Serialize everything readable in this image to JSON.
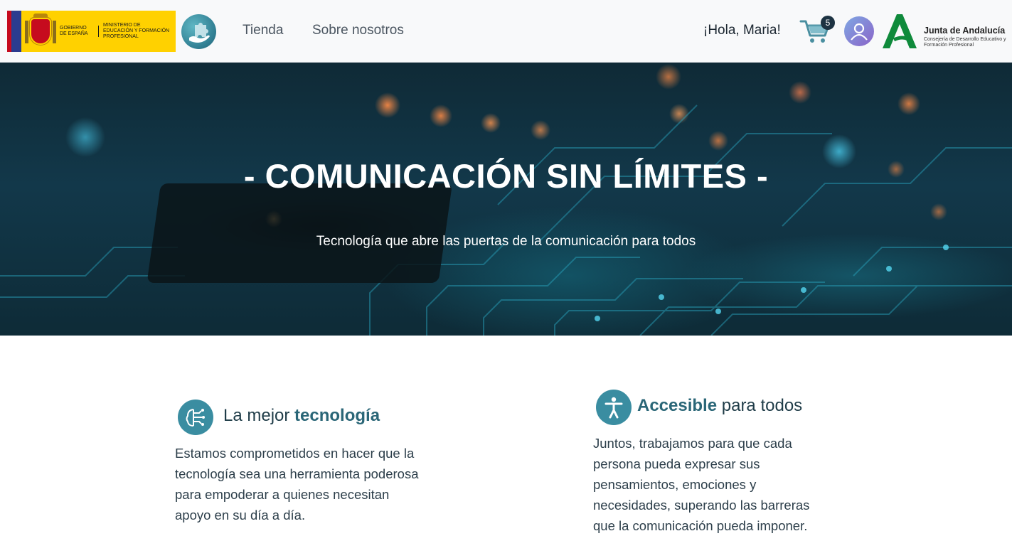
{
  "header": {
    "gov_logo": {
      "left_text": "GOBIERNO DE ESPAÑA",
      "right_text": "MINISTERIO DE EDUCACIÓN Y FORMACIÓN PROFESIONAL"
    },
    "nav": {
      "tienda": "Tienda",
      "sobre": "Sobre nosotros"
    },
    "greeting": "¡Hola, Maria!",
    "cart_count": "5",
    "junta": {
      "title": "Junta de Andalucía",
      "subtitle": "Consejería de Desarrollo Educativo y Formación Profesional"
    },
    "icons": {
      "site_logo": "puzzle-hand-icon",
      "cart": "cart-icon",
      "avatar": "user-icon"
    },
    "colors": {
      "header_bg": "#f8f9fa",
      "accent": "#3a8da1",
      "junta_green": "#0f8a3b",
      "gov_yellow": "#ffd100"
    }
  },
  "hero": {
    "title": "- COMUNICACIÓN SIN LÍMITES -",
    "subtitle": "Tecnología que abre las puertas de la comunicación para todos"
  },
  "features": [
    {
      "icon": "circuit-brain-icon",
      "title_plain": "La mejor ",
      "title_strong": "tecnología",
      "text": "Estamos comprometidos en hacer que la tecnología sea una herramienta poderosa para empoderar a quienes necesitan apoyo en su día a día."
    },
    {
      "icon": "accessibility-icon",
      "title_strong": "Accesible",
      "title_plain": " para todos",
      "text": "Juntos, trabajamos para que cada persona pueda expresar sus pensamientos, emociones y necesidades, superando las barreras que la comunicación pueda imponer."
    }
  ]
}
